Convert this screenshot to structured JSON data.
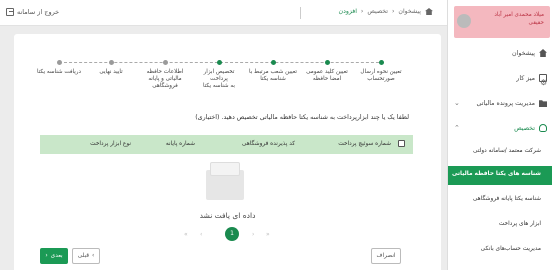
{
  "topbar": {
    "logout_label": "خروج از سامانه",
    "breadcrumb": [
      "پیشخوان",
      "تخصیص",
      "افزودن"
    ]
  },
  "sidebar": {
    "user_line1": "میلاد محمدی امیر آباد",
    "user_line2": "حقیقی",
    "items": [
      {
        "label": "پیشخوان",
        "icon": "home-icon"
      },
      {
        "label": "میز کار",
        "icon": "desk-icon"
      },
      {
        "label": "مدیریت پرونده مالیاتی",
        "icon": "folder-icon"
      },
      {
        "label": "تخصیص",
        "icon": "user-icon"
      }
    ],
    "subitems": [
      {
        "label": "شرکت معتمد /سامانه دولتی"
      },
      {
        "label": "شناسه های یکتا حافظه مالیاتی",
        "active": true
      },
      {
        "label": "شناسه یکتا پایانه فروشگاهی"
      },
      {
        "label": "ابزار های پرداخت"
      },
      {
        "label": "مدیریت حساب‌های بانکی"
      }
    ]
  },
  "steps": [
    {
      "line1": "تعیین نحوه ارسال",
      "line2": "صورتحساب",
      "state": "done"
    },
    {
      "line1": "تعیین کلید عمومی",
      "line2": "امضا حافظه",
      "state": "done"
    },
    {
      "line1": "تعیین شعب مرتبط با",
      "line2": "شناسه یکتا",
      "state": "done"
    },
    {
      "line1": "تخصیص ابزار پرداخت",
      "line2": "به شناسه یکتا",
      "state": "active"
    },
    {
      "line1": "اطلاعات حافظه",
      "line2": "مالیاتی و پایانه",
      "line3": "فروشگاهی",
      "state": "pending"
    },
    {
      "line1": "تایید نهایی",
      "line2": "",
      "state": "pending"
    },
    {
      "line1": "دریافت شناسه یکتا",
      "line2": "",
      "state": "pending"
    }
  ],
  "question": "لطفا یک یا چند ابزارپرداخت به شناسه یکتا حافظه مالیاتی تخصیص دهید. (اختیاری)",
  "table": {
    "headers": [
      "شماره سوئیچ پرداخت",
      "کد پذیرنده فروشگاهی",
      "شماره پایانه",
      "نوع ابزار پرداخت"
    ]
  },
  "empty_text": "داده ای یافت نشد",
  "pager": {
    "current": "1",
    "first": "«",
    "prev": "‹",
    "next": "›",
    "last": "»"
  },
  "buttons": {
    "next": "بعدی",
    "prev": "قبلی",
    "cancel": "انصراف"
  },
  "colors": {
    "accent": "#1b9a55",
    "user_box": "#f4b8bf",
    "table_head": "#c9e7c9"
  }
}
